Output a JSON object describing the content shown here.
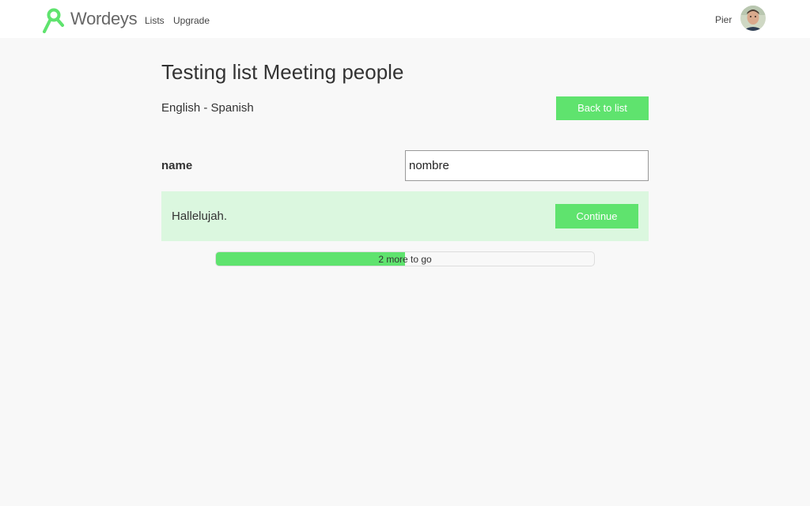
{
  "header": {
    "brand": "Wordeys",
    "nav": [
      {
        "label": "Lists"
      },
      {
        "label": "Upgrade"
      }
    ],
    "user_name": "Pier"
  },
  "page": {
    "title": "Testing list Meeting people",
    "language_pair": "English - Spanish",
    "back_button": "Back to list"
  },
  "quiz": {
    "word": "name",
    "answer_value": "nombre",
    "feedback_text": "Hallelujah.",
    "continue_button": "Continue",
    "progress_text": "2 more to go",
    "progress_fraction": 0.5
  },
  "colors": {
    "accent": "#5fe36e",
    "feedback_bg": "#dbf7df",
    "background": "#f8f8f8"
  }
}
